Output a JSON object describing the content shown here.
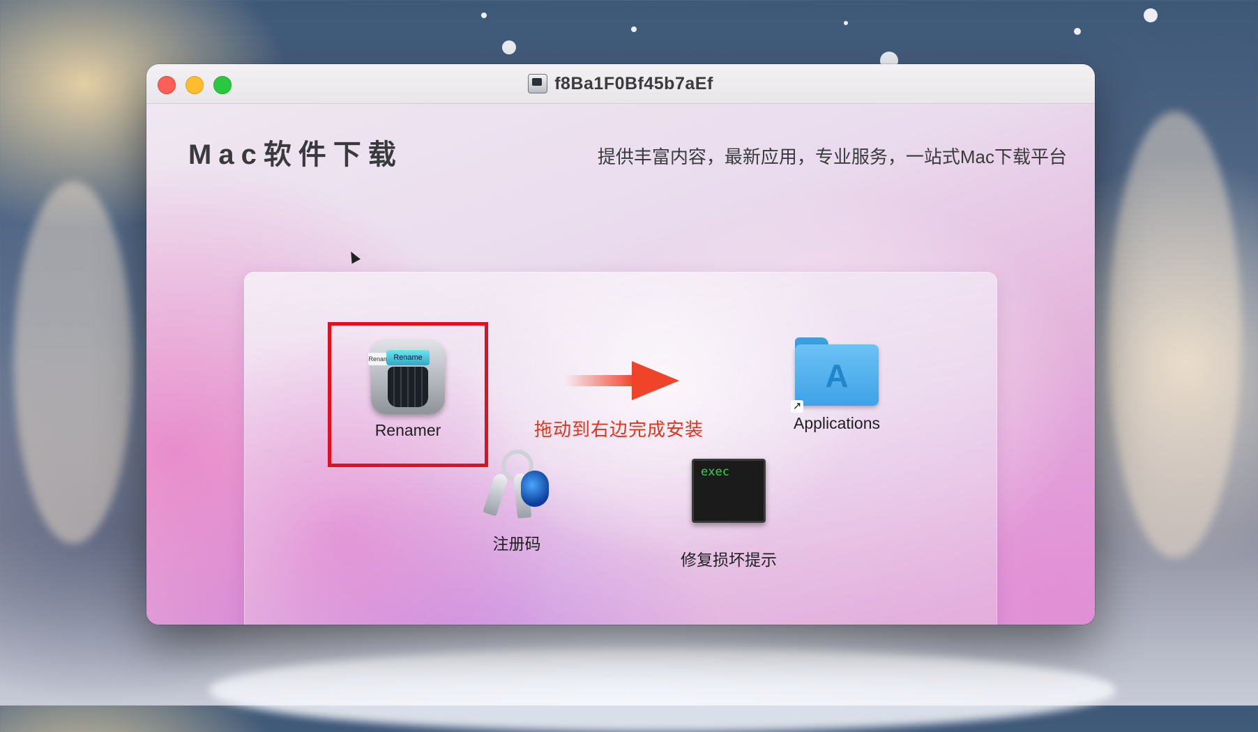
{
  "window": {
    "title": "f8Ba1F0Bf45b7aEf"
  },
  "header": {
    "heading": "Mac软件下载",
    "tagline": "提供丰富内容，最新应用，专业服务，一站式Mac下载平台"
  },
  "items": {
    "app": {
      "label": "Renamer",
      "icon": "renamer-app-icon",
      "screen_text": "Rename",
      "tag_text": "Renam"
    },
    "applications": {
      "label": "Applications",
      "icon": "applications-folder-icon"
    },
    "keys": {
      "label": "注册码",
      "icon": "keychain-icon"
    },
    "exec": {
      "label": "修复损坏提示",
      "icon": "exec-terminal-icon",
      "icon_text": "exec"
    }
  },
  "instruction": "拖动到右边完成安装",
  "colors": {
    "highlight": "#e1101a",
    "instruction": "#e3331b",
    "arrow": "#f0442a"
  }
}
